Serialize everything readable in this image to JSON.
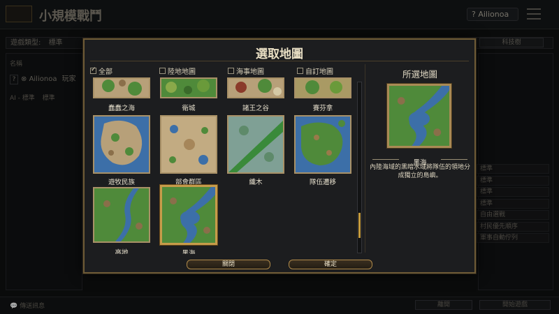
{
  "background": {
    "title": "小規模戰鬥",
    "user": "Ailionoa",
    "game_type_label": "遊戲類型:",
    "game_type_value": "標準",
    "top_right_button": "科技樹",
    "name_header": "名稱",
    "player_name": "Ailionoa",
    "player_tag": "玩家",
    "ai_label": "AI - 標準",
    "ai_value": "標準",
    "right_rows": [
      "標準",
      "標準",
      "標準",
      "標準",
      "自由選戰",
      "村民優先順序",
      "軍事自動佇列"
    ],
    "chat_placeholder": "傳送訊息",
    "bottom_button_1": "離開",
    "bottom_button_2": "開始遊戲"
  },
  "modal": {
    "title": "選取地圖",
    "filters": [
      {
        "label": "全部",
        "checked": true
      },
      {
        "label": "陸地地圖",
        "checked": false
      },
      {
        "label": "海事地圖",
        "checked": false
      },
      {
        "label": "自訂地圖",
        "checked": false
      }
    ],
    "maps_row1": [
      {
        "name": "蠢蠢之海"
      },
      {
        "name": "衛城"
      },
      {
        "name": "諸王之谷"
      },
      {
        "name": "賽芬拿"
      }
    ],
    "maps_row2": [
      {
        "name": "遊牧民族"
      },
      {
        "name": "部會群區"
      },
      {
        "name": "纖木"
      },
      {
        "name": "隊伍遷移"
      }
    ],
    "maps_row3": [
      {
        "name": "高地"
      },
      {
        "name": "黑海"
      }
    ],
    "selected_index": "row3.1",
    "scroll_position": 0.9,
    "selected_panel": {
      "title": "所選地圖",
      "map_name": "黑海",
      "description_line1": "內陸海域的黑暗水域將隊伍的領地分",
      "description_line2": "成獨立的島嶼。"
    },
    "buttons": {
      "close": "關閉",
      "confirm": "確定"
    }
  },
  "colors": {
    "gold_border": "#a99167",
    "water": "#3c6fa8",
    "grass": "#4f8a3a",
    "sand": "#b7a079"
  }
}
